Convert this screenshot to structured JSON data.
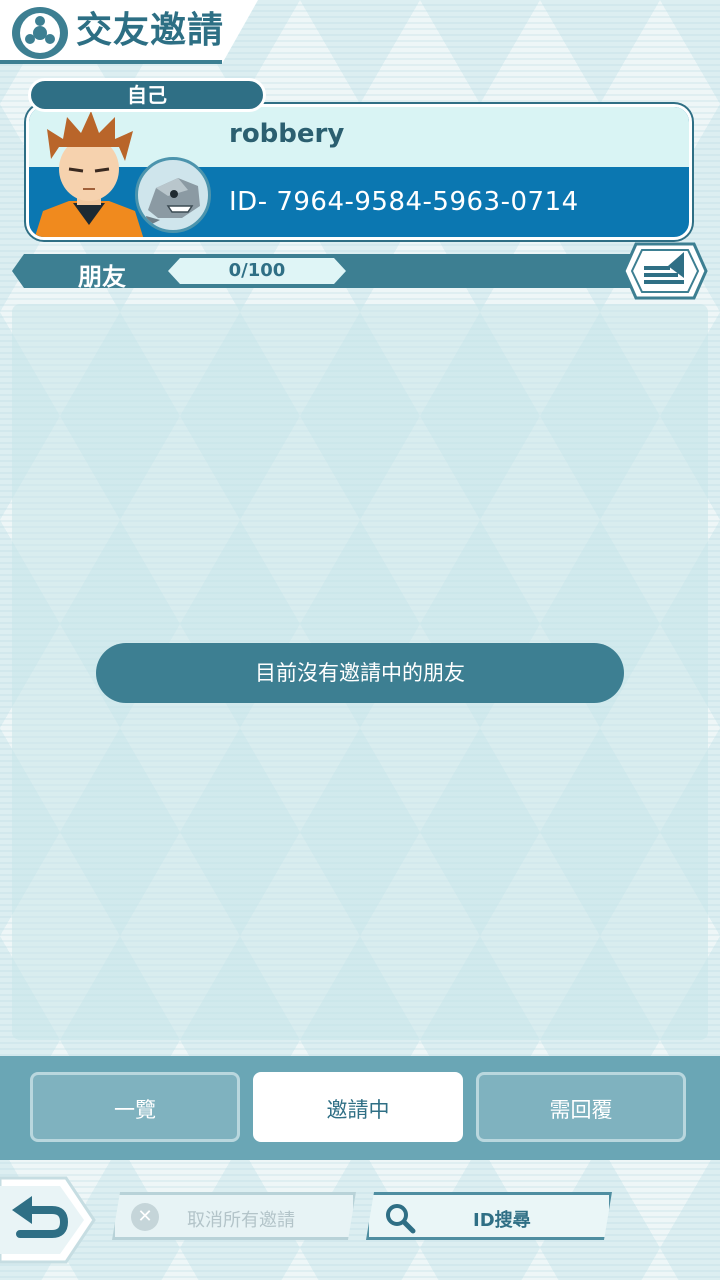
{
  "header": {
    "title": "交友邀請",
    "icon": "friends-icon"
  },
  "profile": {
    "tag": "自己",
    "name": "robbery",
    "id_text": "ID- 7964-9584-5963-0714",
    "avatar": "trainer-avatar",
    "partner": "steelix-icon"
  },
  "friends": {
    "label": "朋友",
    "count": "0/100",
    "sort_icon": "sort-icon"
  },
  "list": {
    "empty_message": "目前沒有邀請中的朋友"
  },
  "tabs": [
    {
      "label": "一覽",
      "active": false
    },
    {
      "label": "邀請中",
      "active": true
    },
    {
      "label": "需回覆",
      "active": false
    }
  ],
  "bottom": {
    "back_icon": "back-arrow-icon",
    "cancel_all_label": "取消所有邀請",
    "cancel_all_icon": "close-icon",
    "id_search_label": "ID搜尋",
    "id_search_icon": "search-icon"
  },
  "colors": {
    "primary": "#3d7f92",
    "card_blue": "#0b77b1",
    "tab_bar": "#6aa6b5"
  }
}
